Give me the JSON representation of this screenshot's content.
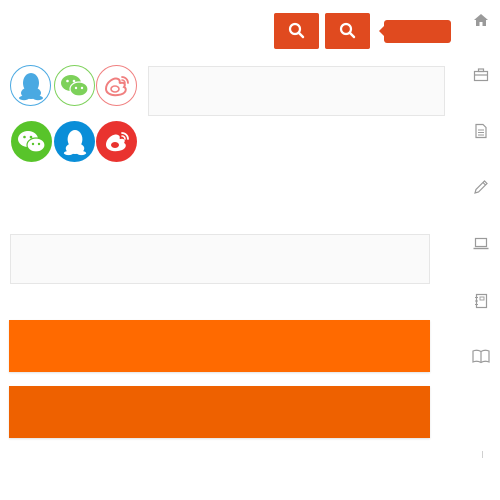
{
  "colors": {
    "accent": "#e04a1f",
    "qq_blue": "#0a8ed8",
    "qq_outline": "#4aa9e2",
    "wechat_green": "#58c42a",
    "wechat_outline": "#7dd15a",
    "weibo_red": "#e9332f",
    "weibo_outline": "#f07f7f",
    "bar_primary": "#ff6a00",
    "bar_secondary": "#ee6100",
    "sidebar_icon": "#9a9a9a"
  },
  "toolbar": {
    "search_icon": "search-icon",
    "search_icon_alt": "search-icon",
    "tooltip_label": ""
  },
  "social": {
    "outline_row": [
      "qq-icon",
      "wechat-icon",
      "weibo-icon"
    ],
    "filled_row": [
      "wechat-icon",
      "qq-icon",
      "weibo-icon"
    ]
  },
  "inputs": {
    "top_panel_value": "",
    "middle_panel_value": ""
  },
  "bars": {
    "primary_label": "",
    "secondary_label": ""
  },
  "sidebar": {
    "icons": [
      "home-icon",
      "briefcase-icon",
      "document-icon",
      "pencil-icon",
      "laptop-icon",
      "notebook-icon",
      "book-icon"
    ]
  }
}
